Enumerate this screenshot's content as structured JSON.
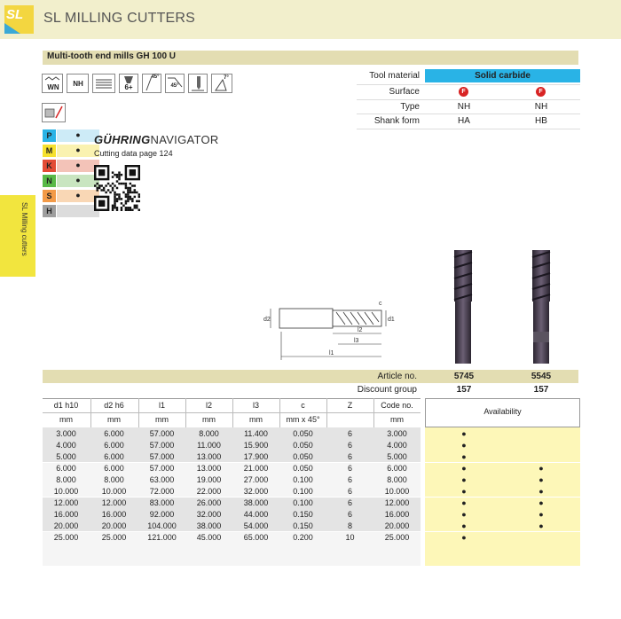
{
  "header": {
    "logo_text": "SL",
    "title": "SL MILLING CUTTERS"
  },
  "product_title": "Multi-tooth end mills GH 100 U",
  "side_tab": "SL Milling cutters",
  "icons": [
    "WN",
    "NH",
    "6+",
    "45°",
    "45°",
    "7°"
  ],
  "properties": {
    "rows": [
      {
        "label": "Tool material",
        "values": [
          "Solid carbide"
        ]
      },
      {
        "label": "Surface",
        "values": [
          "F",
          "F"
        ]
      },
      {
        "label": "Type",
        "values": [
          "NH",
          "NH"
        ]
      },
      {
        "label": "Shank form",
        "values": [
          "HA",
          "HB"
        ]
      }
    ]
  },
  "navigator": {
    "brand_bold": "GÜHRING",
    "brand_light": "NAVIGATOR",
    "cutting_data": "Cutting data page 124"
  },
  "materials": [
    {
      "letter": "P",
      "dot": "●",
      "color": "#29b3e6",
      "bar": "#cdebf7"
    },
    {
      "letter": "M",
      "dot": "●",
      "color": "#f6e12e",
      "bar": "#faf2b0"
    },
    {
      "letter": "K",
      "dot": "●",
      "color": "#e34b35",
      "bar": "#f3c3b8"
    },
    {
      "letter": "N",
      "dot": "●",
      "color": "#58b947",
      "bar": "#c9e5c0"
    },
    {
      "letter": "S",
      "dot": "●",
      "color": "#f39a47",
      "bar": "#f9d7b5"
    },
    {
      "letter": "H",
      "dot": "",
      "color": "#9e9e9e",
      "bar": "#dcdcdc"
    }
  ],
  "drawing": {
    "d1": "d1",
    "d2": "d2",
    "c": "c",
    "l1": "l1",
    "l2": "l2",
    "l3": "l3"
  },
  "article": {
    "article_label": "Article no.",
    "discount_label": "Discount group",
    "article_numbers": [
      "5745",
      "5545"
    ],
    "discount_groups": [
      "157",
      "157"
    ]
  },
  "table": {
    "headers": [
      "d1 h10",
      "d2 h6",
      "l1",
      "l2",
      "l3",
      "c",
      "Z",
      "Code no."
    ],
    "units": [
      "mm",
      "mm",
      "mm",
      "mm",
      "mm",
      "mm x 45°",
      "",
      "mm"
    ],
    "availability_label": "Availability",
    "rows": [
      {
        "cells": [
          "3.000",
          "6.000",
          "57.000",
          "8.000",
          "11.400",
          "0.050",
          "6",
          "3.000"
        ],
        "avail": [
          "●",
          ""
        ]
      },
      {
        "cells": [
          "4.000",
          "6.000",
          "57.000",
          "11.000",
          "15.900",
          "0.050",
          "6",
          "4.000"
        ],
        "avail": [
          "●",
          ""
        ]
      },
      {
        "cells": [
          "5.000",
          "6.000",
          "57.000",
          "13.000",
          "17.900",
          "0.050",
          "6",
          "5.000"
        ],
        "avail": [
          "●",
          ""
        ]
      },
      {
        "cells": [
          "6.000",
          "6.000",
          "57.000",
          "13.000",
          "21.000",
          "0.050",
          "6",
          "6.000"
        ],
        "avail": [
          "●",
          "●"
        ]
      },
      {
        "cells": [
          "8.000",
          "8.000",
          "63.000",
          "19.000",
          "27.000",
          "0.100",
          "6",
          "8.000"
        ],
        "avail": [
          "●",
          "●"
        ]
      },
      {
        "cells": [
          "10.000",
          "10.000",
          "72.000",
          "22.000",
          "32.000",
          "0.100",
          "6",
          "10.000"
        ],
        "avail": [
          "●",
          "●"
        ]
      },
      {
        "cells": [
          "12.000",
          "12.000",
          "83.000",
          "26.000",
          "38.000",
          "0.100",
          "6",
          "12.000"
        ],
        "avail": [
          "●",
          "●"
        ]
      },
      {
        "cells": [
          "16.000",
          "16.000",
          "92.000",
          "32.000",
          "44.000",
          "0.150",
          "6",
          "16.000"
        ],
        "avail": [
          "●",
          "●"
        ]
      },
      {
        "cells": [
          "20.000",
          "20.000",
          "104.000",
          "38.000",
          "54.000",
          "0.150",
          "8",
          "20.000"
        ],
        "avail": [
          "●",
          "●"
        ]
      },
      {
        "cells": [
          "25.000",
          "25.000",
          "121.000",
          "45.000",
          "65.000",
          "0.200",
          "10",
          "25.000"
        ],
        "avail": [
          "●",
          ""
        ]
      }
    ]
  },
  "colors": {
    "header_bg": "#f2efcc",
    "subheader_bg": "#e3ddb2",
    "tool_material_bg": "#29b3e6",
    "table_group_a": "#e4e4e4",
    "table_group_b": "#f5f5f5",
    "availability_bg": "#fdf7b8",
    "side_tab": "#f2e53e"
  }
}
